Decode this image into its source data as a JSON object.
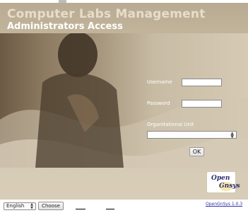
{
  "header": {
    "title": "Computer Labs Management",
    "subtitle": "Administrators Access"
  },
  "login": {
    "username_label": "Username",
    "username_value": "",
    "password_label": "Password",
    "password_value": "",
    "ou_label": "Organitational Unit",
    "ou_value": "",
    "ok_label": "OK"
  },
  "logo": {
    "line1": "Open",
    "line2": "Gnsys"
  },
  "footer": {
    "language_value": "English",
    "choose_label": "Choose",
    "version_link": "OpenGnSys 1.0.3"
  },
  "colors": {
    "title_primary": "#e7ddcc",
    "title_secondary": "#ffffff",
    "panel_background": "#d4c8b2",
    "link": "#3333aa"
  }
}
